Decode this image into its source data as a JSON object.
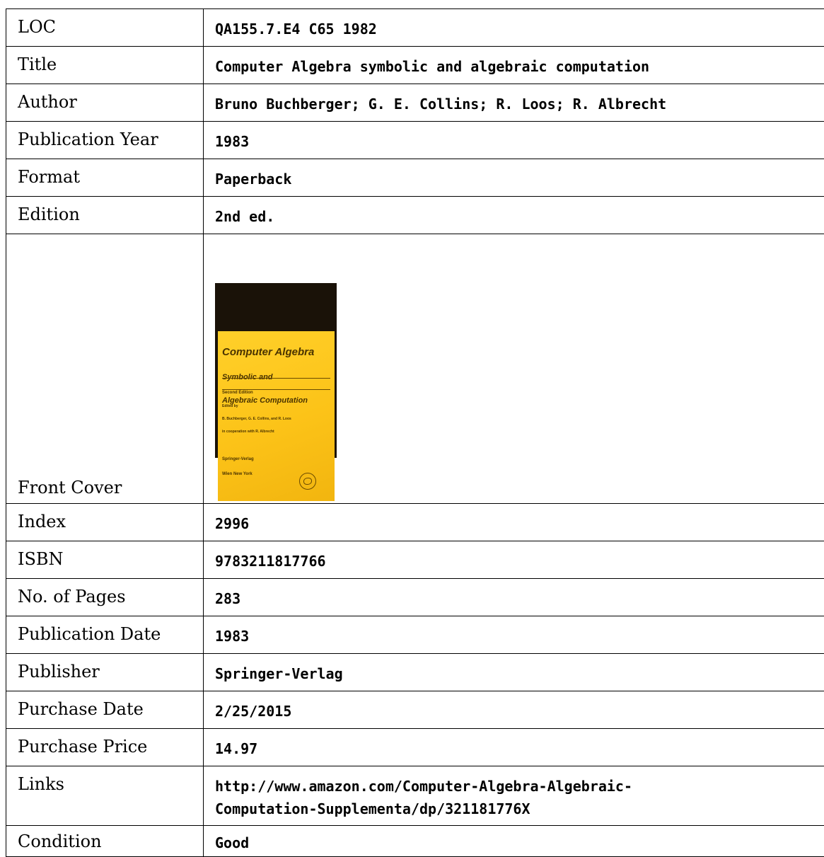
{
  "record": {
    "loc_label": "LOC",
    "loc_value": "QA155.7.E4 C65 1982",
    "title_label": "Title",
    "title_value": "Computer Algebra symbolic and algebraic computation",
    "author_label": "Author",
    "author_value": "Bruno Buchberger; G. E. Collins; R. Loos; R. Albrecht",
    "pubyear_label": "Publication Year",
    "pubyear_value": "1983",
    "format_label": "Format",
    "format_value": "Paperback",
    "edition_label": "Edition",
    "edition_value": "2nd ed.",
    "cover_label": "Front Cover",
    "index_label": "Index",
    "index_value": "2996",
    "isbn_label": "ISBN",
    "isbn_value": "9783211817766",
    "pages_label": "No. of Pages",
    "pages_value": "283",
    "pubdate_label": "Publication Date",
    "pubdate_value": "1983",
    "publisher_label": "Publisher",
    "publisher_value": "Springer-Verlag",
    "purchase_date_label": "Purchase Date",
    "purchase_date_value": "2/25/2015",
    "purchase_price_label": "Purchase Price",
    "purchase_price_value": "14.97",
    "links_label": "Links",
    "links_value": "http://www.amazon.com/Computer-Algebra-Algebraic-\nComputation-Supplementa/dp/321181776X",
    "condition_label": "Condition",
    "condition_value": "Good"
  },
  "cover": {
    "title": "Computer Algebra",
    "subtitle_1": "Symbolic and",
    "subtitle_2": "Algebraic Computation",
    "edition": "Second Edition",
    "edited_1": "Edited by",
    "edited_2": "B. Buchberger, G. E. Collins, and R. Loos",
    "edited_3": "in cooperation with R. Albrecht",
    "publisher_1": "Springer-Verlag",
    "publisher_2": "Wien New York",
    "background_color": "#fcc318"
  }
}
